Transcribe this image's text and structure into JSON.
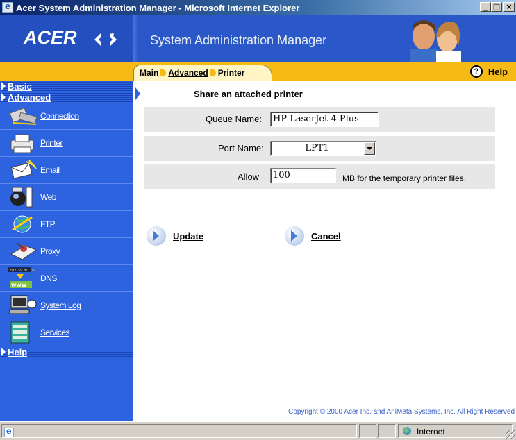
{
  "window": {
    "title": "Acer System Administration Manager - Microsoft Internet Explorer",
    "buttons": {
      "minimize": "_",
      "maximize": "□",
      "close": "×"
    }
  },
  "header": {
    "logo": "ACER",
    "title": "System Administration Manager"
  },
  "breadcrumb": {
    "items": [
      "Main",
      "Advanced",
      "Printer"
    ]
  },
  "help": {
    "label": "Help",
    "icon_glyph": "?"
  },
  "sidebar": {
    "sections": {
      "basic": "Basic",
      "advanced": "Advanced",
      "help": "Help"
    },
    "items": [
      {
        "label": "Connection",
        "icon": "connection-icon"
      },
      {
        "label": "Printer",
        "icon": "printer-icon"
      },
      {
        "label": "Email",
        "icon": "email-icon"
      },
      {
        "label": "Web",
        "icon": "web-icon"
      },
      {
        "label": "FTP",
        "icon": "ftp-icon"
      },
      {
        "label": "Proxy",
        "icon": "proxy-icon"
      },
      {
        "label": "DNS",
        "icon": "dns-icon",
        "icon_text": "202.39.80.16"
      },
      {
        "label": "System Log",
        "icon": "system-log-icon"
      },
      {
        "label": "Services",
        "icon": "services-icon"
      }
    ]
  },
  "form": {
    "title": "Share an attached printer",
    "queue_name": {
      "label": "Queue Name:",
      "value": "HP LaserJet 4 Plus"
    },
    "port_name": {
      "label": "Port Name:",
      "value": "LPT1"
    },
    "allow": {
      "label": "Allow",
      "value": "100",
      "suffix": "MB for the temporary printer files."
    }
  },
  "actions": {
    "update": "Update",
    "cancel": "Cancel"
  },
  "copyright": "Copyright © 2000   Acer Inc. and AniMeta Systems, Inc.   All Right Reserved",
  "statusbar": {
    "zone": "Internet"
  },
  "colors": {
    "sidebar": "#2e63e0",
    "band": "#f5ba16",
    "header": "#2a58c8"
  }
}
